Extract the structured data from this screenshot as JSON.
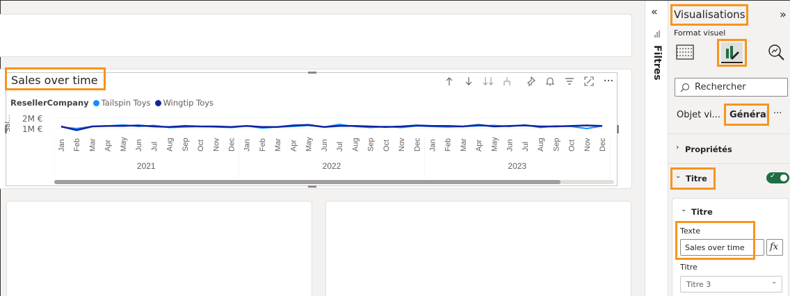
{
  "visual": {
    "title": "Sales over time",
    "legend_title": "ResellerCompany",
    "y_axis_label": "Sal...",
    "toolbar_icons": [
      "arrow-up-icon",
      "arrow-down-icon",
      "drill-all-icon",
      "expand-hierarchy-icon",
      "pin-icon",
      "bell-icon",
      "filter-icon",
      "focus-mode-icon",
      "more-options-icon"
    ]
  },
  "chart_data": {
    "type": "line",
    "yticks": [
      "2M €",
      "1M €"
    ],
    "ylim": [
      0,
      2000000
    ],
    "x_months": [
      "Jan",
      "Feb",
      "Mar",
      "Apr",
      "May",
      "Jun",
      "Jul",
      "Aug",
      "Sep",
      "Oct",
      "Nov",
      "Dec",
      "Jan",
      "Feb",
      "Mar",
      "Apr",
      "May",
      "Jun",
      "Jul",
      "Aug",
      "Sep",
      "Oct",
      "Nov",
      "Dec",
      "Jan",
      "Feb",
      "Mar",
      "Apr",
      "May",
      "Jun",
      "Jul",
      "Aug",
      "Sep",
      "Oct",
      "Nov",
      "Dec"
    ],
    "x_years": [
      "2021",
      "2022",
      "2023"
    ],
    "series": [
      {
        "name": "Tailspin Toys",
        "color": "#118dff",
        "values": [
          1150000,
          1000000,
          1200000,
          1250000,
          1350000,
          1200000,
          1300000,
          1100000,
          1150000,
          1200000,
          1150000,
          1100000,
          1250000,
          1050000,
          1150000,
          1200000,
          1300000,
          1150000,
          1400000,
          1200000,
          1100000,
          1200000,
          1100000,
          1250000,
          1200000,
          1150000,
          1200000,
          1250000,
          1300000,
          1200000,
          1350000,
          1100000,
          1250000,
          1200000,
          1000000,
          1250000
        ]
      },
      {
        "name": "Wingtip Toys",
        "color": "#12239e",
        "values": [
          1200000,
          850000,
          1200000,
          1250000,
          1250000,
          1300000,
          1200000,
          1150000,
          1250000,
          1200000,
          1200000,
          1150000,
          1250000,
          1150000,
          1150000,
          1300000,
          1350000,
          1150000,
          1250000,
          1250000,
          1200000,
          1150000,
          1200000,
          1300000,
          1250000,
          1250000,
          1200000,
          1350000,
          1200000,
          1250000,
          1300000,
          1200000,
          1200000,
          1250000,
          1300000,
          1250000
        ]
      }
    ]
  },
  "filters_pane": {
    "collapse_glyph": "«",
    "label": "Filtres"
  },
  "viz_pane": {
    "title": "Visualisations",
    "expand_glyph": "»",
    "format_label": "Format visuel",
    "search_placeholder": "Rechercher",
    "object_label": "Objet vi...",
    "object_value": "Général",
    "more_glyph": "···",
    "properties_label": "Propriétés",
    "title_section_label": "Titre",
    "title_toggle_on": true,
    "title_sub_label": "Titre",
    "text_label": "Texte",
    "text_value": "Sales over time",
    "fx_label": "fx",
    "title_level_label": "Titre",
    "title_level_value": "Titre 3"
  }
}
